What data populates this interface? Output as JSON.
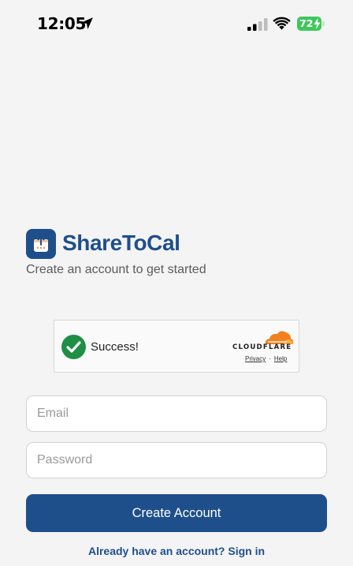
{
  "status_bar": {
    "time": "12:05",
    "battery": "72",
    "icons": [
      "location-arrow-icon",
      "cellular-signal-icon",
      "wifi-icon",
      "battery-charging-icon"
    ]
  },
  "brand": {
    "app_name": "ShareToCal",
    "tagline": "Create an account to get started",
    "logo_icon": "share-calendar-icon",
    "accent_color": "#1f4f8b"
  },
  "captcha": {
    "status": "Success!",
    "provider": "CLOUDFLARE",
    "privacy_link": "Privacy",
    "separator": "·",
    "help_link": "Help",
    "success_color": "#1f8f45",
    "provider_color": "#f38020"
  },
  "form": {
    "email_placeholder": "Email",
    "email_value": "",
    "password_placeholder": "Password",
    "password_value": "",
    "submit_label": "Create Account"
  },
  "footer": {
    "signin_text": "Already have an account? Sign in"
  }
}
